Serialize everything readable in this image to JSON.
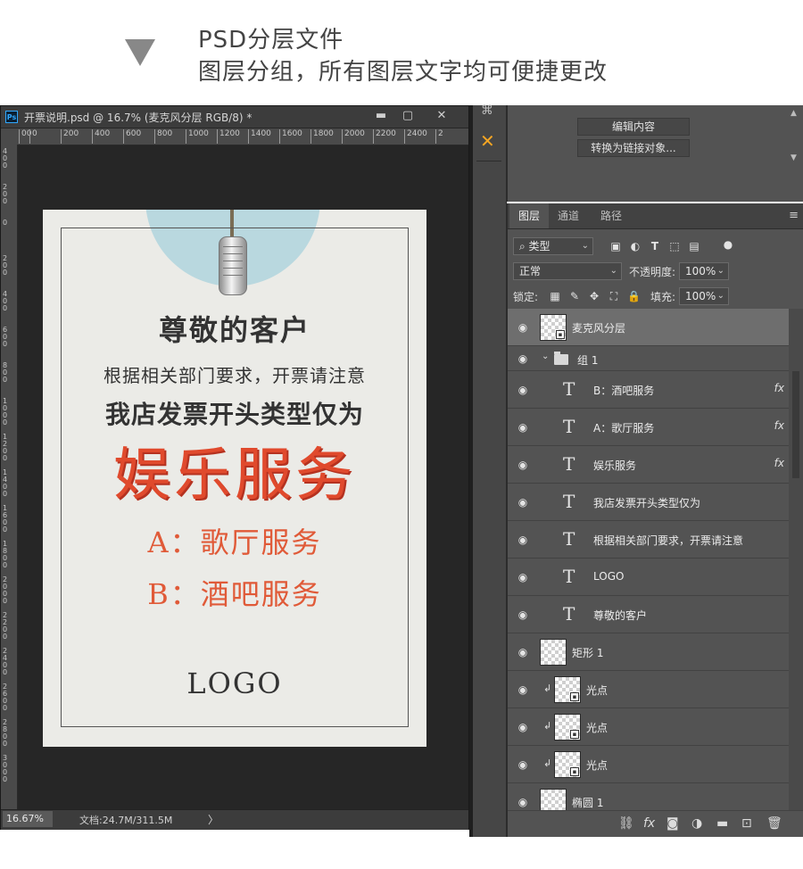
{
  "caption": {
    "line1": "PSD分层文件",
    "line2": "图层分组，所有图层文字均可便捷更改"
  },
  "document": {
    "tab_title": "开票说明.psd @ 16.7% (麦克风分层 RGB/8) *",
    "icon_label": "Ps",
    "controls": {
      "minimize": "▬",
      "maximize": "▢",
      "close": "✕"
    },
    "ruler_h": [
      "00",
      "0",
      "200",
      "400",
      "600",
      "800",
      "1000",
      "1200",
      "1400",
      "1600",
      "1800",
      "2000",
      "2200",
      "2400",
      "2"
    ],
    "ruler_v": [
      "400",
      "200",
      "0",
      "200",
      "400",
      "600",
      "800",
      "1000",
      "1200",
      "1400",
      "1600",
      "1800",
      "2000",
      "2200",
      "2400",
      "2600",
      "2800",
      "3000"
    ],
    "artboard": {
      "respect": "尊敬的客户",
      "notice": "根据相关部门要求，开票请注意",
      "type_line": "我店发票开头类型仅为",
      "entertainment": "娱乐服务",
      "ktv": "A：歌厅服务",
      "bar": "B：酒吧服务",
      "logo": "LOGO"
    },
    "status": {
      "zoom": "16.67%",
      "doc_info": "文档:24.7M/311.5M",
      "arrow": "〉"
    }
  },
  "properties": {
    "edit_contents": "编辑内容",
    "convert_linked": "转换为链接对象..."
  },
  "layers_panel": {
    "tabs": [
      "图层",
      "通道",
      "路径"
    ],
    "filter_kind": "类型",
    "blend_mode": "正常",
    "opacity_label": "不透明度:",
    "opacity_value": "100%",
    "lock_label": "锁定:",
    "fill_label": "填充:",
    "fill_value": "100%",
    "layers": [
      {
        "name": "麦克风分层",
        "kind": "smart",
        "selected": true
      },
      {
        "name": "组 1",
        "kind": "group"
      },
      {
        "name": "B：酒吧服务",
        "kind": "text",
        "fx": true
      },
      {
        "name": "A：歌厅服务",
        "kind": "text",
        "fx": true
      },
      {
        "name": "娱乐服务",
        "kind": "text",
        "fx": true
      },
      {
        "name": "我店发票开头类型仅为",
        "kind": "text"
      },
      {
        "name": "根据相关部门要求，开票请注意",
        "kind": "text"
      },
      {
        "name": "LOGO",
        "kind": "text"
      },
      {
        "name": "尊敬的客户",
        "kind": "text"
      },
      {
        "name": "矩形 1",
        "kind": "shape"
      },
      {
        "name": "光点",
        "kind": "smart-clip"
      },
      {
        "name": "光点",
        "kind": "smart-clip"
      },
      {
        "name": "光点",
        "kind": "smart-clip"
      },
      {
        "name": "椭圆 1",
        "kind": "shape"
      }
    ],
    "fx_label": "fx"
  },
  "colors": {
    "accent_red": "#e04a2d",
    "panel_bg": "#535353",
    "canvas_bg": "#262626",
    "paper": "#ebebe7"
  }
}
